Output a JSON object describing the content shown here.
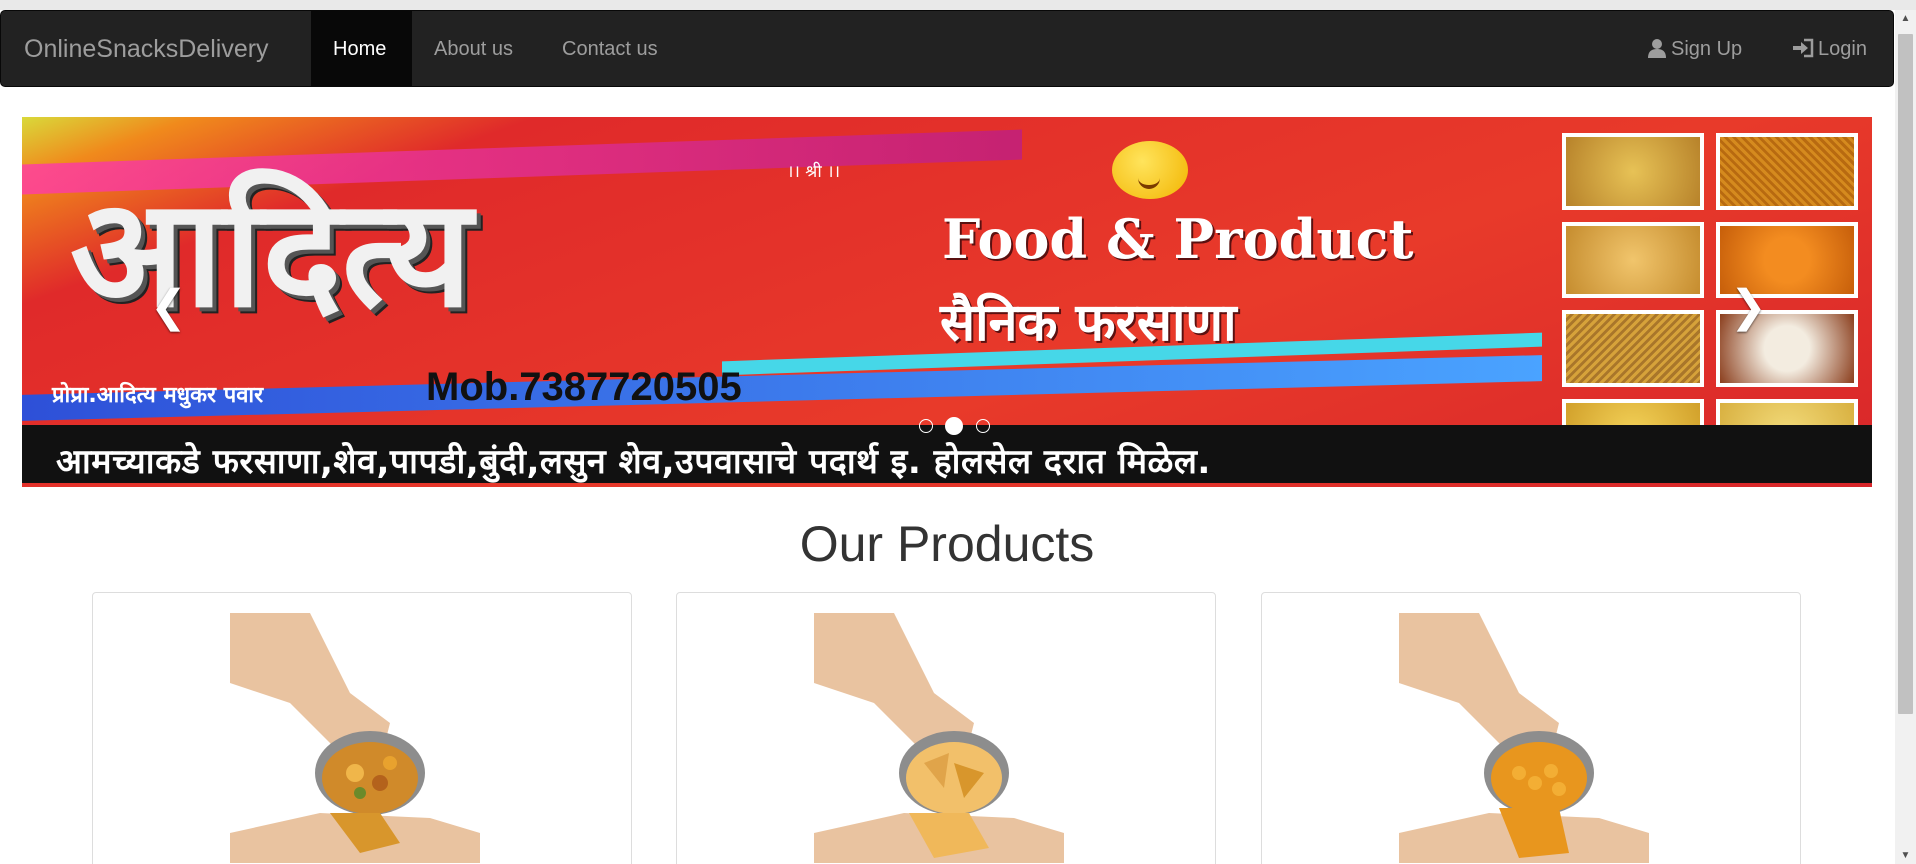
{
  "navbar": {
    "brand": "OnlineSnacksDelivery",
    "items": [
      {
        "label": "Home",
        "active": true
      },
      {
        "label": "About us",
        "active": false
      },
      {
        "label": "Contact us",
        "active": false
      }
    ],
    "right_items": [
      {
        "label": "Sign Up",
        "icon": "user-icon"
      },
      {
        "label": "Login",
        "icon": "login-icon"
      }
    ]
  },
  "carousel": {
    "banner": {
      "logo_text": "आदित्य",
      "shri": "।। श्री ।।",
      "title": "Food & Product",
      "subtitle": "सैनिक फरसाणा",
      "proprietor": "प्रोप्रा.आदित्य मधुकर पवार",
      "mobile": "Mob.7387720505",
      "ticker": "आमच्याकडे फरसाणा,शेव,पापडी,बुंदी,लसुन शेव,उपवासाचे पदार्थ इ. होलसेल दरात मिळेल."
    },
    "prev_icon": "chevron-left-icon",
    "next_icon": "chevron-right-icon",
    "indicator_count": 3,
    "active_indicator": 1
  },
  "products": {
    "title": "Our Products",
    "cards": [
      {
        "image": "mixed-farsan-in-hand"
      },
      {
        "image": "chips-in-hand"
      },
      {
        "image": "boondi-in-hand"
      }
    ]
  },
  "colors": {
    "navbar_bg": "#222222",
    "navbar_active": "#080808",
    "nav_text": "#9d9d9d",
    "banner_red": "#e02a2a"
  }
}
